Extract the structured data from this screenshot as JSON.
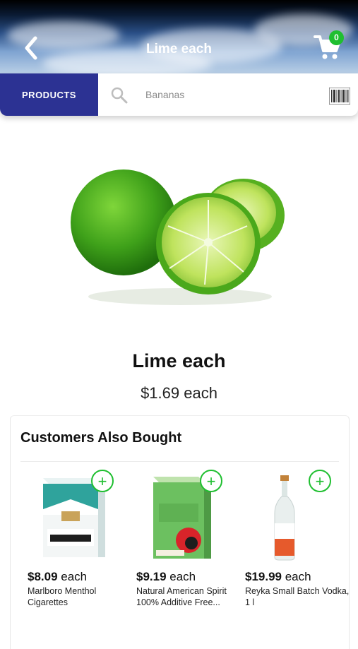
{
  "header": {
    "title": "Lime each",
    "cart_count": "0",
    "back_icon": "chevron-left-icon",
    "cart_icon": "shopping-cart-icon"
  },
  "searchbar": {
    "products_label": "PRODUCTS",
    "placeholder": "Bananas",
    "search_icon": "search-icon",
    "barcode_icon": "barcode-icon"
  },
  "product": {
    "name": "Lime each",
    "price": "$1.69 each"
  },
  "also_bought": {
    "title": "Customers Also Bought",
    "items": [
      {
        "price": "$8.09",
        "unit": " each",
        "name": "Marlboro Menthol Cigarettes"
      },
      {
        "price": "$9.19",
        "unit": " each",
        "name": "Natural American Spirit 100% Additive Free..."
      },
      {
        "price": "$19.99",
        "unit": " each",
        "name": "Reyka Small Batch Vodka, 1 l"
      }
    ]
  },
  "colors": {
    "accent_navy": "#2c3293",
    "add_green": "#1fbf30"
  }
}
